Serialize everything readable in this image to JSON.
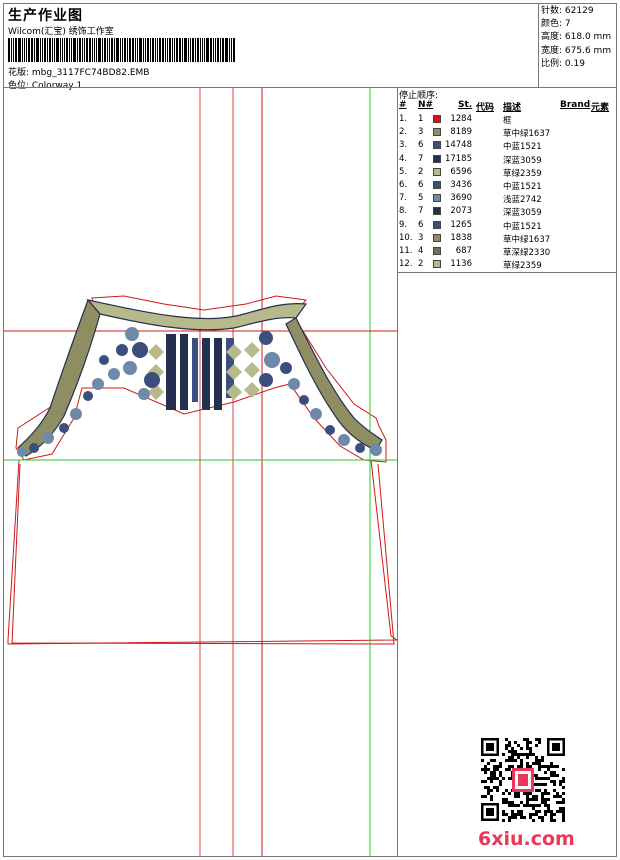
{
  "header": {
    "title": "生产作业图",
    "company": "Wilcom(汇宝) 绣饰工作室",
    "design_file": "花版: mbg_3117FC74BD82.EMB",
    "colorway": "色位: Colorway 1"
  },
  "stats": [
    {
      "label": "针数:",
      "value": "62129"
    },
    {
      "label": "颜色:",
      "value": "7"
    },
    {
      "label": "高度:",
      "value": "618.0 mm"
    },
    {
      "label": "宽度:",
      "value": "675.6 mm"
    },
    {
      "label": "比例:",
      "value": "0.19"
    }
  ],
  "stop_list": {
    "title": "停止顺序:",
    "headers": [
      "#",
      "N#",
      "St.",
      "代码",
      "描述",
      "Brand",
      "元素"
    ],
    "rows": [
      {
        "num": "1.",
        "n": "1",
        "color": "#e01010",
        "st": "1284",
        "desc": "框"
      },
      {
        "num": "2.",
        "n": "3",
        "color": "#8e8e62",
        "st": "8189",
        "desc": "草中绿1637"
      },
      {
        "num": "3.",
        "n": "6",
        "color": "#3a4f7e",
        "st": "14748",
        "desc": "中蓝1521"
      },
      {
        "num": "4.",
        "n": "7",
        "color": "#24304f",
        "st": "17185",
        "desc": "深蓝3059"
      },
      {
        "num": "5.",
        "n": "2",
        "color": "#b7b98a",
        "st": "6596",
        "desc": "草绿2359"
      },
      {
        "num": "6.",
        "n": "6",
        "color": "#3a4f7e",
        "st": "3436",
        "desc": "中蓝1521"
      },
      {
        "num": "7.",
        "n": "5",
        "color": "#6e8aa8",
        "st": "3690",
        "desc": "浅蓝2742"
      },
      {
        "num": "8.",
        "n": "7",
        "color": "#24304f",
        "st": "2073",
        "desc": "深蓝3059"
      },
      {
        "num": "9.",
        "n": "6",
        "color": "#3a4f7e",
        "st": "1265",
        "desc": "中蓝1521"
      },
      {
        "num": "10.",
        "n": "3",
        "color": "#8e8e62",
        "st": "1838",
        "desc": "草中绿1637"
      },
      {
        "num": "11.",
        "n": "4",
        "color": "#6f7153",
        "st": "687",
        "desc": "草深绿2330"
      },
      {
        "num": "12.",
        "n": "2",
        "color": "#b7b98a",
        "st": "1136",
        "desc": "草绿2359"
      }
    ]
  },
  "watermark": "6xiu.com"
}
